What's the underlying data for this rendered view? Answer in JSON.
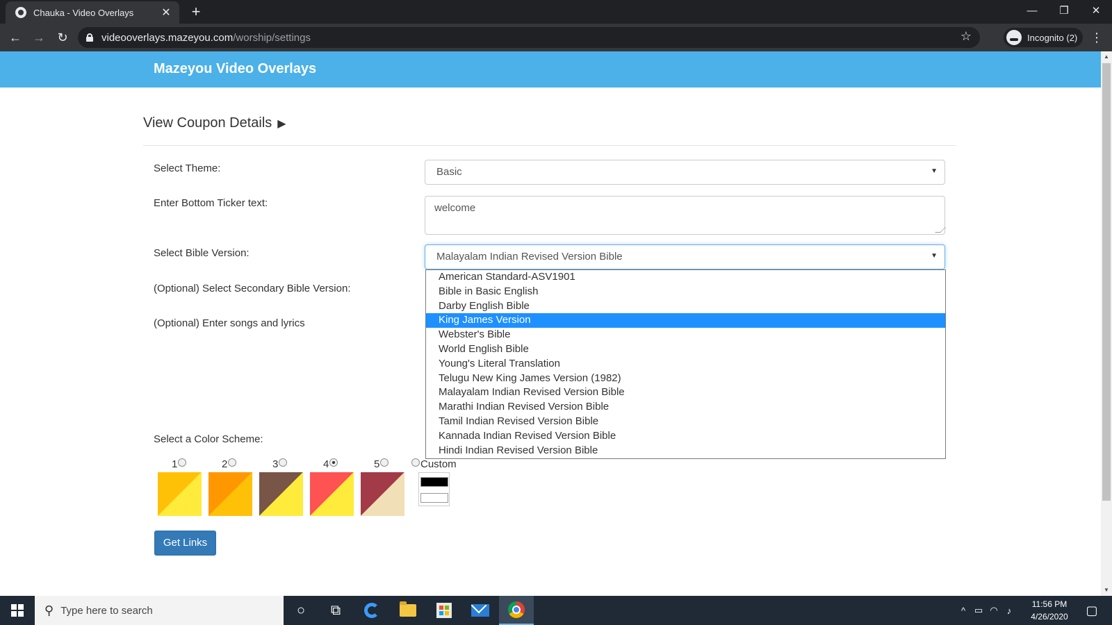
{
  "browser": {
    "tab_title": "Chauka - Video Overlays",
    "tab_close": "✕",
    "new_tab": "+",
    "url_host": "videooverlays.mazeyou.com",
    "url_path": "/worship/settings",
    "incognito_label": "Incognito (2)",
    "window_controls": {
      "minimize": "—",
      "restore": "❐",
      "close": "✕"
    }
  },
  "page": {
    "brand": "Mazeyou Video Overlays",
    "coupon_link": "View Coupon Details",
    "coupon_arrow": "▶",
    "labels": {
      "theme": "Select Theme:",
      "ticker": "Enter Bottom Ticker text:",
      "bible": "Select Bible Version:",
      "secondary": "(Optional) Select Secondary Bible Version:",
      "songs": "(Optional) Enter songs and lyrics",
      "color_scheme": "Select a Color Scheme:"
    },
    "theme_value": "Basic",
    "ticker_value": "welcome",
    "bible_value": "Malayalam Indian Revised Version Bible",
    "bible_options": [
      "American Standard-ASV1901",
      "Bible in Basic English",
      "Darby English Bible",
      "King James Version",
      "Webster's Bible",
      "World English Bible",
      "Young's Literal Translation",
      "Telugu New King James Version (1982)",
      "Malayalam Indian Revised Version Bible",
      "Marathi Indian Revised Version Bible",
      "Tamil Indian Revised Version Bible",
      "Kannada Indian Revised Version Bible",
      "Hindi Indian Revised Version Bible"
    ],
    "highlighted_option_index": 3,
    "color_schemes": [
      {
        "label": "1",
        "top": "#ffc107",
        "bottom": "#ffeb3b",
        "selected": false
      },
      {
        "label": "2",
        "top": "#ff9800",
        "bottom": "#ffc107",
        "selected": false
      },
      {
        "label": "3",
        "top": "#795548",
        "bottom": "#ffeb3b",
        "selected": false
      },
      {
        "label": "4",
        "top": "#ff5252",
        "bottom": "#ffeb3b",
        "selected": true
      },
      {
        "label": "5",
        "top": "#a33a48",
        "bottom": "#f1dfb7",
        "selected": false
      }
    ],
    "custom_label": "Custom",
    "custom_colors": [
      "#000000",
      "#ffffff"
    ],
    "get_links_button": "Get Links",
    "accent_color": "#4bb1e8"
  },
  "taskbar": {
    "search_placeholder": "Type here to search",
    "time": "11:56 PM",
    "date": "4/26/2020"
  }
}
